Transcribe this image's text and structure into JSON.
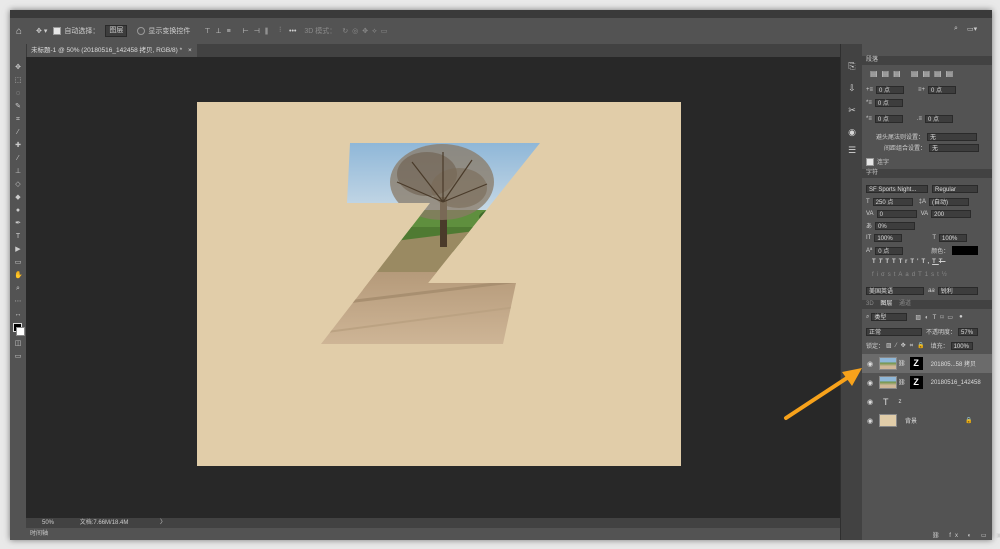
{
  "options_bar": {
    "auto_select_label": "自动选择：",
    "auto_select_value": "图层",
    "show_transform_label": "显示变换控件",
    "mode_3d_label": "3D 模式：",
    "more": "•••"
  },
  "doc_tab": {
    "label": "未标题-1 @ 50% (20180516_142458 拷贝, RGB/8) *",
    "close": "×"
  },
  "status": {
    "zoom": "50%",
    "doc_info": "文档:7.66M/18.4M",
    "arrow": "〉"
  },
  "timeline_label": "时间轴",
  "paragraph_panel": {
    "title": "段落",
    "indent_left": "0 点",
    "indent_right": "0 点",
    "first_line": "0 点",
    "space_before": "0 点",
    "space_after": "0 点",
    "kinsoku_label": "避头尾法则设置：",
    "kinsoku_value": "无",
    "mojikumi_label": "间距组合设置：",
    "mojikumi_value": "无",
    "hyphenate_label": "连字"
  },
  "character_panel": {
    "title": "字符",
    "font_family": "SF Sports Night...",
    "font_style": "Regular",
    "size": "250 点",
    "leading": "(自动)",
    "kerning": "0",
    "tracking": "200",
    "tsume": "0%",
    "vscale": "100%",
    "hscale": "100%",
    "baseline": "0 点",
    "color_label": "颜色：",
    "color_value": "#000000",
    "styles": [
      "T",
      "T",
      "TT",
      "Tr",
      "T'",
      "T,",
      "T",
      "T"
    ],
    "opentype": [
      "fi",
      "σ",
      "st",
      "A",
      "ad",
      "T",
      "1st",
      "½"
    ],
    "language": "美国英语",
    "aa_label": "aa",
    "aa_value": "锐利"
  },
  "layers_panel": {
    "tabs": [
      "3D",
      "图层",
      "通道"
    ],
    "filter_label": "类型",
    "blend_mode": "正常",
    "opacity_label": "不透明度：",
    "opacity_value": "57%",
    "lock_label": "锁定：",
    "fill_label": "填充：",
    "fill_value": "100%",
    "layers": [
      {
        "name": "201805...58 拷贝",
        "mask_letter": "Z",
        "selected": true
      },
      {
        "name": "20180516_142458",
        "mask_letter": "Z",
        "selected": false
      },
      {
        "name": "z",
        "type_icon": "T",
        "selected": false
      },
      {
        "name": "背景",
        "locked": true,
        "selected": false
      }
    ]
  },
  "colors": {
    "doc_background": "#e1cda9",
    "arrow": "#f7a21b",
    "workspace": "#282828"
  }
}
